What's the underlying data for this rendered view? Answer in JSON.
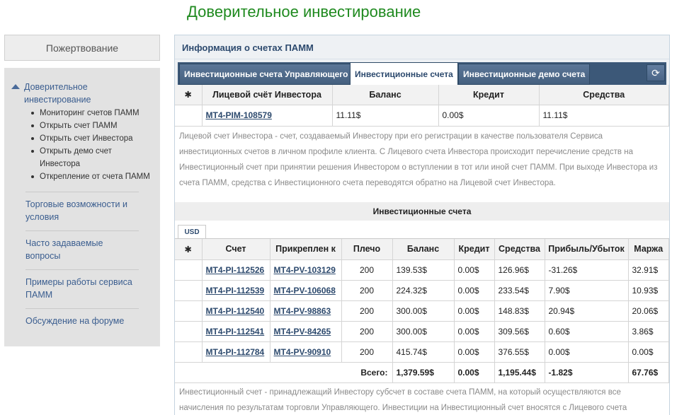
{
  "page_title": "Доверительное инвестирование",
  "donate_button": "Пожертвование",
  "sidebar": {
    "section_title": "Доверительное инвестирование",
    "sub_items": [
      "Мониторинг счетов ПАММ",
      "Открыть счет ПАММ",
      "Открыть счет Инвестора",
      "Открыть демо счет Инвестора",
      "Открепление от счета ПАММ"
    ],
    "links": [
      "Торговые возможности и условия",
      "Часто задаваемые вопросы",
      "Примеры работы сервиса ПАММ",
      "Обсуждение на форуме"
    ]
  },
  "panel": {
    "title": "Информация о счетах ПАММ",
    "tabs": [
      "Инвестиционные счета Управляющего",
      "Инвестиционные счета",
      "Инвестиционные демо счета"
    ],
    "active_tab": 1,
    "refresh_icon": "refresh-icon"
  },
  "personal_table": {
    "headers": [
      "Лицевой счёт Инвестора",
      "Баланс",
      "Кредит",
      "Средства"
    ],
    "row": {
      "account": "MT4-PIM-108579",
      "balance": "11.11$",
      "credit": "0.00$",
      "funds": "11.11$"
    }
  },
  "personal_desc": "Лицевой счет Инвестора - счет, создаваемый Инвестору при его регистрации в качестве пользователя Сервиса инвестиционных счетов в личном профиле клиента. С Лицевого счета Инвестора происходит перечисление средств на Инвестиционный счет при принятии решения Инвестором о вступлении в тот или иной счет ПАММ. При выходе Инвестора из счета ПАММ, средства с Инвестиционного счета переводятся обратно на Лицевой счет Инвестора.",
  "invest_section_title": "Инвестиционные счета",
  "currency_tab": "USD",
  "invest_table": {
    "headers": [
      "Счет",
      "Прикреплен к",
      "Плечо",
      "Баланс",
      "Кредит",
      "Средства",
      "Прибыль/Убыток",
      "Маржа"
    ],
    "rows": [
      {
        "account": "MT4-PI-112526",
        "attached": "MT4-PV-103129",
        "leverage": "200",
        "balance": "139.53$",
        "credit": "0.00$",
        "funds": "126.96$",
        "pl": "-31.26$",
        "margin": "32.91$"
      },
      {
        "account": "MT4-PI-112539",
        "attached": "MT4-PV-106068",
        "leverage": "200",
        "balance": "224.32$",
        "credit": "0.00$",
        "funds": "233.54$",
        "pl": "7.90$",
        "margin": "10.93$"
      },
      {
        "account": "MT4-PI-112540",
        "attached": "MT4-PV-98863",
        "leverage": "200",
        "balance": "300.00$",
        "credit": "0.00$",
        "funds": "148.83$",
        "pl": "20.94$",
        "margin": "20.06$"
      },
      {
        "account": "MT4-PI-112541",
        "attached": "MT4-PV-84265",
        "leverage": "200",
        "balance": "300.00$",
        "credit": "0.00$",
        "funds": "309.56$",
        "pl": "0.60$",
        "margin": "3.86$"
      },
      {
        "account": "MT4-PI-112784",
        "attached": "MT4-PV-90910",
        "leverage": "200",
        "balance": "415.74$",
        "credit": "0.00$",
        "funds": "376.55$",
        "pl": "0.00$",
        "margin": "0.00$"
      }
    ],
    "total": {
      "label": "Всего:",
      "balance": "1,379.59$",
      "credit": "0.00$",
      "funds": "1,195.44$",
      "pl": "-1.82$",
      "margin": "67.76$"
    }
  },
  "invest_desc": "Инвестиционный счет - принадлежащий Инвестору субсчет в составе счета ПАММ, на который осуществляются все начисления по результатам торговли Управляющего. Инвестиции на Инвестиционный счет вносятся с Лицевого счета Инвестора."
}
